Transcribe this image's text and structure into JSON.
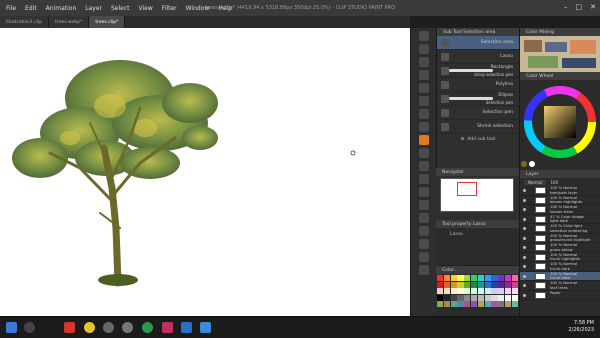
{
  "window": {
    "title": "trees.webp* (4419.94 x 5318.89px 350dpi 25.0%)  - CLIP STUDIO PAINT PRO",
    "menu": [
      "File",
      "Edit",
      "Animation",
      "Layer",
      "Select",
      "View",
      "Filter",
      "Window",
      "Help"
    ],
    "controls": [
      "–",
      "□",
      "✕"
    ]
  },
  "tabs": [
    "Illustration1.clip",
    "trees.webp*",
    "trees.clip*"
  ],
  "subtool": {
    "header": "Sub Tool  Selection area",
    "items": [
      "Selection area",
      "Lasso",
      "Rectangle",
      "Polyline",
      "Ellipse",
      "Selection pen",
      "Shrink selection"
    ],
    "sublabels": [
      "sharp selection pen",
      "Selection pen"
    ],
    "add_label": "Add sub tool"
  },
  "navigator": {
    "header": "Navigator"
  },
  "toolprop": {
    "header": "Tool property  Lasso",
    "label": "Lasso"
  },
  "colorset": {
    "header": "Color..."
  },
  "right": {
    "mixing_header": "Color Mixing",
    "wheel_header": "Color Wheel",
    "layers_header": "Layer",
    "blend_mode": "Normal",
    "opacity": "100",
    "layers": [
      {
        "label": "100 % Normal\ntree(part layer"
      },
      {
        "label": "100 % Normal\nleaves highlights"
      },
      {
        "label": "100 % Normal\nleaves trees"
      },
      {
        "label": "47 % Color dodge\nlight dark"
      },
      {
        "label": "100 % Vivid light\nselection scattering"
      },
      {
        "label": "100 % Normal\ngrassthumb highlight"
      },
      {
        "label": "100 % Normal\ngrass below"
      },
      {
        "label": "100 % Normal\ntrunk highlights"
      },
      {
        "label": "100 % Normal\ntrunk dark"
      },
      {
        "label": "100 % Normal\ntrunk base"
      },
      {
        "label": "100 % Normal\nleaf trees"
      },
      {
        "label": "Paper"
      }
    ],
    "selected_index": 9
  },
  "taskbar": {
    "time": "7:58 PM",
    "date": "2/26/2023"
  },
  "colors": {
    "accent": "#e07a24",
    "selection": "#4a6080"
  }
}
